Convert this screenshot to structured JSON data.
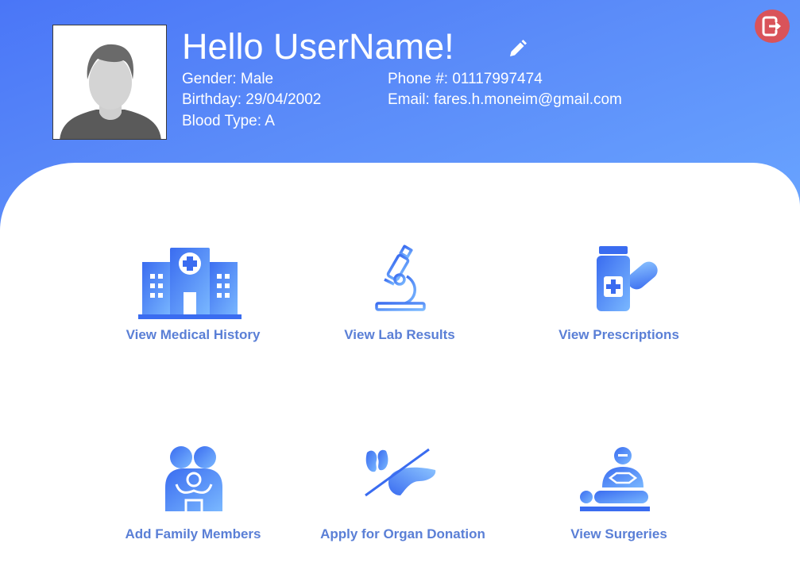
{
  "header": {
    "greeting": "Hello UserName!",
    "gender": "Gender: Male",
    "birthday": "Birthday: 29/04/2002",
    "blood_type": "Blood Type: A",
    "phone": "Phone #: 01117997474",
    "email": "Email: fares.h.moneim@gmail.com"
  },
  "icons": {
    "edit": "pencil-icon",
    "logout": "logout-icon",
    "avatar": "avatar-placeholder"
  },
  "actions": [
    {
      "label": "View Medical History",
      "icon": "hospital-icon"
    },
    {
      "label": "View Lab Results",
      "icon": "microscope-icon"
    },
    {
      "label": "View Prescriptions",
      "icon": "medicine-icon"
    },
    {
      "label": "Add Family Members",
      "icon": "family-icon"
    },
    {
      "label": "Apply for Organ Donation",
      "icon": "organ-donation-icon"
    },
    {
      "label": "View Surgeries",
      "icon": "surgery-icon"
    }
  ],
  "colors": {
    "header_gradient_start": "#4a76f7",
    "header_gradient_end": "#6aa6ff",
    "label": "#5a7fd6",
    "logout": "#d9535a"
  }
}
